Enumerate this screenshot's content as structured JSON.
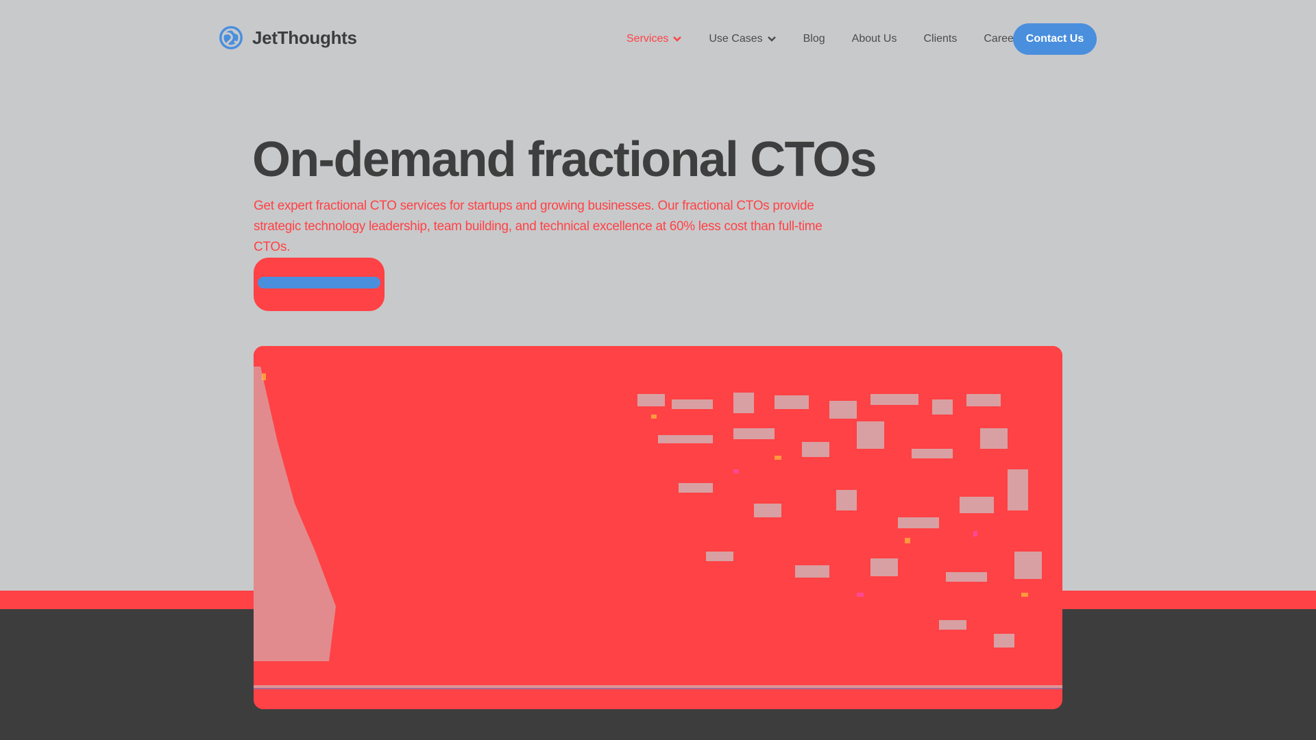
{
  "brand": {
    "name": "JetThoughts",
    "logo_icon": "globe-logo-icon",
    "accent_color": "#ff4245",
    "link_color": "#4a8fde"
  },
  "nav": {
    "items": [
      {
        "label": "Services",
        "active": true,
        "has_dropdown": true
      },
      {
        "label": "Use Cases",
        "active": false,
        "has_dropdown": true
      },
      {
        "label": "Blog",
        "active": false,
        "has_dropdown": false
      },
      {
        "label": "About Us",
        "active": false,
        "has_dropdown": false
      },
      {
        "label": "Clients",
        "active": false,
        "has_dropdown": false
      },
      {
        "label": "Careers",
        "active": false,
        "has_dropdown": false
      }
    ],
    "contact_label": "Contact Us"
  },
  "hero": {
    "title": "On-demand fractional CTOs",
    "subtitle": "Get expert fractional CTO services for startups and growing businesses. Our fractional CTOs provide strategic technology leadership, team building, and technical excellence at 60% less cost than full-time CTOs.",
    "cta_label": ""
  },
  "image": {
    "description_icon": "hero-photo"
  }
}
